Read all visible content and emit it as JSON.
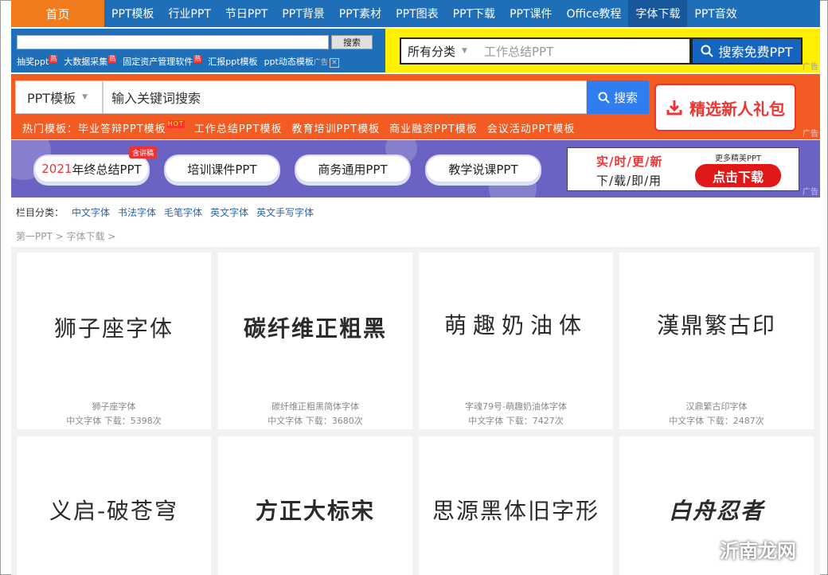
{
  "nav": {
    "home": "首页",
    "items": [
      "PPT模板",
      "行业PPT",
      "节日PPT",
      "PPT背景",
      "PPT素材",
      "PPT图表",
      "PPT下载",
      "PPT课件",
      "Office教程",
      "字体下载",
      "PPT音效"
    ],
    "active_index": 9
  },
  "top_search": {
    "button": "搜索",
    "links": [
      {
        "text": "抽奖ppt",
        "hot": "热"
      },
      {
        "text": "大数据采集",
        "hot": "热"
      },
      {
        "text": "固定资产管理软件",
        "hot": "热"
      },
      {
        "text": "汇报ppt模板",
        "hot": ""
      },
      {
        "text": "ppt动态模板",
        "hot": ""
      }
    ],
    "ad_tag": "广告",
    "close": "✕"
  },
  "free_search": {
    "category": "所有分类",
    "placeholder": "工作总结PPT",
    "button": "搜索免费PPT",
    "ad": "广告"
  },
  "template_search": {
    "category": "PPT模板",
    "placeholder": "输入关键词搜索",
    "button": "搜索",
    "gift": "精选新人礼包",
    "hot_label": "热门模板：",
    "hot_items": [
      "毕业答辩PPT模板",
      "工作总结PPT模板",
      "教育培训PPT模板",
      "商业融资PPT模板",
      "会议活动PPT模板"
    ],
    "hot_badge": "HOT",
    "ad": "广告"
  },
  "banner": {
    "pills": [
      {
        "prefix": "2021",
        "text": "年终总结PPT"
      },
      {
        "prefix": "",
        "text": "培训课件PPT"
      },
      {
        "prefix": "",
        "text": "商务通用PPT"
      },
      {
        "prefix": "",
        "text": "教学说课PPT"
      }
    ],
    "pill_badge": "含讲稿",
    "ad_line1": "实/时/更/新",
    "ad_line2": "下/载/即/用",
    "ad_more": "更多精美PPT",
    "ad_button": "点击下载",
    "ad": "广告"
  },
  "categories": {
    "label": "栏目分类：",
    "links": [
      "中文字体",
      "书法字体",
      "毛笔字体",
      "英文字体",
      "英文手写字体"
    ]
  },
  "breadcrumb": "第一PPT > 字体下载 >",
  "fonts": [
    {
      "preview": "狮子座字体",
      "name": "狮子座字体",
      "category": "中文字体",
      "downloads": "下载：5398次"
    },
    {
      "preview": "碳纤维正粗黑",
      "name": "碳纤维正粗黑简体字体",
      "category": "中文字体",
      "downloads": "下载：3680次"
    },
    {
      "preview": "萌趣奶油体",
      "name": "字魂79号-萌趣奶油体字体",
      "category": "中文字体",
      "downloads": "下载：7427次"
    },
    {
      "preview": "漢鼎繁古印",
      "name": "汉鼎繁古印字体",
      "category": "中文字体",
      "downloads": "下载：2487次"
    },
    {
      "preview": "义启-破苍穹",
      "name": "",
      "category": "",
      "downloads": ""
    },
    {
      "preview": "方正大标宋",
      "name": "",
      "category": "",
      "downloads": ""
    },
    {
      "preview": "思源黑体旧字形",
      "name": "",
      "category": "",
      "downloads": ""
    },
    {
      "preview": "白舟忍者",
      "name": "",
      "category": "",
      "downloads": ""
    }
  ],
  "watermark": "沂南龙网",
  "colors": {
    "nav": "#1e6fb8",
    "home": "#f07c1e",
    "orange_bar": "#f25b22",
    "yellow_bar": "#ffef00",
    "banner": "#6b63c4",
    "link": "#2a64b5"
  }
}
